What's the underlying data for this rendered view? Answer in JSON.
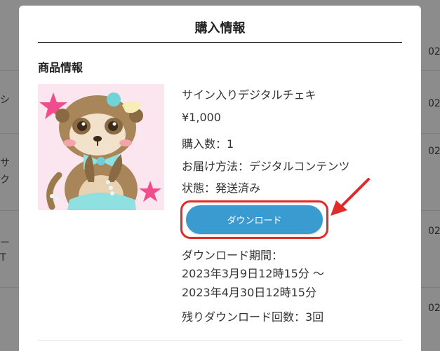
{
  "background": {
    "fragments": [
      "ッ",
      "02",
      "シ",
      "02",
      "サ",
      "ク",
      "02",
      "ー",
      "T",
      "02",
      "02"
    ]
  },
  "modal": {
    "title": "購入情報",
    "section_heading": "商品情報",
    "product": {
      "name": "サイン入りデジタルチェキ",
      "price": "¥1,000",
      "quantity": "購入数：1",
      "delivery_method": "お届け方法：デジタルコンテンツ",
      "status": "状態：発送済み"
    },
    "download_button_label": "ダウンロード",
    "download_period": {
      "label": "ダウンロード期間：",
      "range_line1": "2023年3月9日12時15分 〜",
      "range_line2": "2023年4月30日12時15分"
    },
    "remaining_downloads": "残りダウンロード回数：3回"
  },
  "colors": {
    "button": "#3a9bd1",
    "highlight": "#e02b2b"
  },
  "icons": {
    "annotation": "red-arrow-icon"
  }
}
